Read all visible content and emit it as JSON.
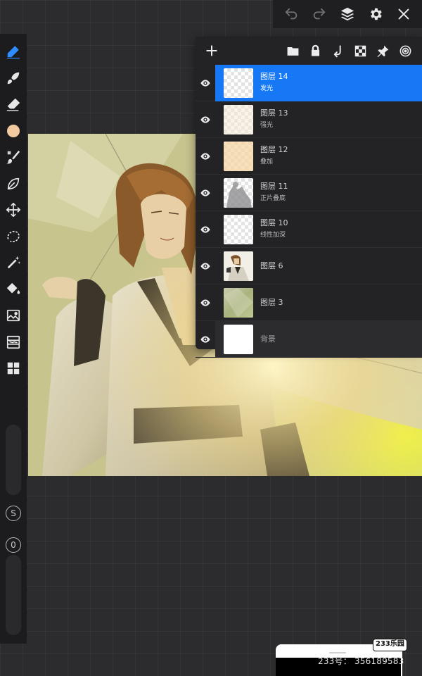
{
  "top_toolbar": {
    "undo_icon": "undo-arrow-icon",
    "redo_icon": "redo-arrow-icon",
    "layers_icon": "layers-stack-icon",
    "settings_icon": "gear-icon",
    "close_icon": "close-x-icon"
  },
  "left_toolbar": {
    "tools": [
      "brush-pen-icon",
      "smudge-icon",
      "eraser-icon",
      "color-swatch",
      "paint-brush-icon",
      "leaf-shape-icon",
      "transform-move-icon",
      "lasso-select-icon",
      "magic-wand-icon",
      "paint-bucket-icon",
      "image-import-icon",
      "adjustments-icon",
      "layout-grid-icon"
    ],
    "active_color": "#f3c9a0",
    "active_accent": "#2e8cff",
    "size_knob_label": "S",
    "opacity_knob_label": "0"
  },
  "layers_panel": {
    "header_icons": [
      "add-plus-icon",
      "folder-icon",
      "lock-icon",
      "merge-down-icon",
      "checker-transparency-icon",
      "pin-icon",
      "target-rings-icon"
    ],
    "selected_color": "#1778f5",
    "layers": [
      {
        "name": "图层 14",
        "mode": "发光"
      },
      {
        "name": "图层 13",
        "mode": "强光"
      },
      {
        "name": "图层 12",
        "mode": "叠加"
      },
      {
        "name": "图层 11",
        "mode": "正片叠底"
      },
      {
        "name": "图层 10",
        "mode": "线性加深"
      },
      {
        "name": "图层 6",
        "mode": ""
      },
      {
        "name": "图层 3",
        "mode": ""
      },
      {
        "name": "背景",
        "mode": ""
      }
    ]
  },
  "watermark": {
    "logo": "233乐园",
    "id_text": "233号： 356189583"
  }
}
